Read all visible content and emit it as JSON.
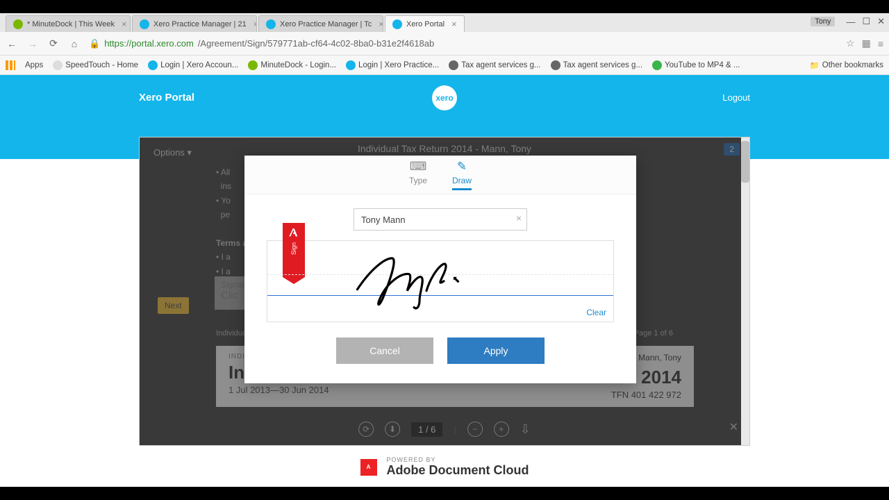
{
  "browser": {
    "user": "Tony",
    "tabs": [
      {
        "title": "* MinuteDock | This Week",
        "fav": "#7ab800"
      },
      {
        "title": "Xero Practice Manager | 21",
        "fav": "#13b5ea"
      },
      {
        "title": "Xero Practice Manager | Tc",
        "fav": "#13b5ea"
      },
      {
        "title": "Xero Portal",
        "fav": "#13b5ea",
        "active": true
      }
    ],
    "url_host": "https://portal.xero.com",
    "url_path": "/Agreement/Sign/579771ab-cf64-4c02-8ba0-b31e2f4618ab",
    "bookmarks_label": "Apps",
    "bookmarks": [
      {
        "title": "SpeedTouch - Home",
        "fav": "#ddd"
      },
      {
        "title": "Login | Xero Accoun...",
        "fav": "#13b5ea"
      },
      {
        "title": "MinuteDock - Login...",
        "fav": "#7ab800"
      },
      {
        "title": "Login | Xero Practice...",
        "fav": "#13b5ea"
      },
      {
        "title": "Tax agent services g...",
        "fav": "#666"
      },
      {
        "title": "Tax agent services g...",
        "fav": "#666"
      },
      {
        "title": "YouTube to MP4 & ...",
        "fav": "#3bb54a"
      }
    ],
    "other_bookmarks": "Other bookmarks"
  },
  "xero": {
    "brand": "Xero Portal",
    "logo": "xero",
    "logout": "Logout"
  },
  "viewer": {
    "options": "Options ▾",
    "doc_title": "Individual Tax Return 2014 - Mann, Tony",
    "badge": "2",
    "bg_lines": {
      "a": "All",
      "b": "ins",
      "c": "Yo",
      "d": "pe",
      "e": "Terms a",
      "f": "I a",
      "g": "I a"
    },
    "next": "Next",
    "sig_label": "Signat",
    "sig_click": "Clic",
    "foot_l": "Individual",
    "foot_r": "Page 1 of 6",
    "card": {
      "small": "INDIVIDU",
      "name": "Mann, Tony",
      "big": "Individual Tax Return",
      "year": "2014",
      "dates": "1 Jul 2013—30 Jun 2014",
      "tfn": "TFN 401 422 972"
    },
    "toolbar": {
      "page": "1 / 6"
    }
  },
  "modal": {
    "tab_type": "Type",
    "tab_draw": "Draw",
    "name_value": "Tony Mann",
    "flag_text": "Sign",
    "clear": "Clear",
    "cancel": "Cancel",
    "apply": "Apply"
  },
  "footer": {
    "powered": "POWERED BY",
    "brand": "Adobe Document Cloud",
    "logo_text": "Adobe"
  }
}
